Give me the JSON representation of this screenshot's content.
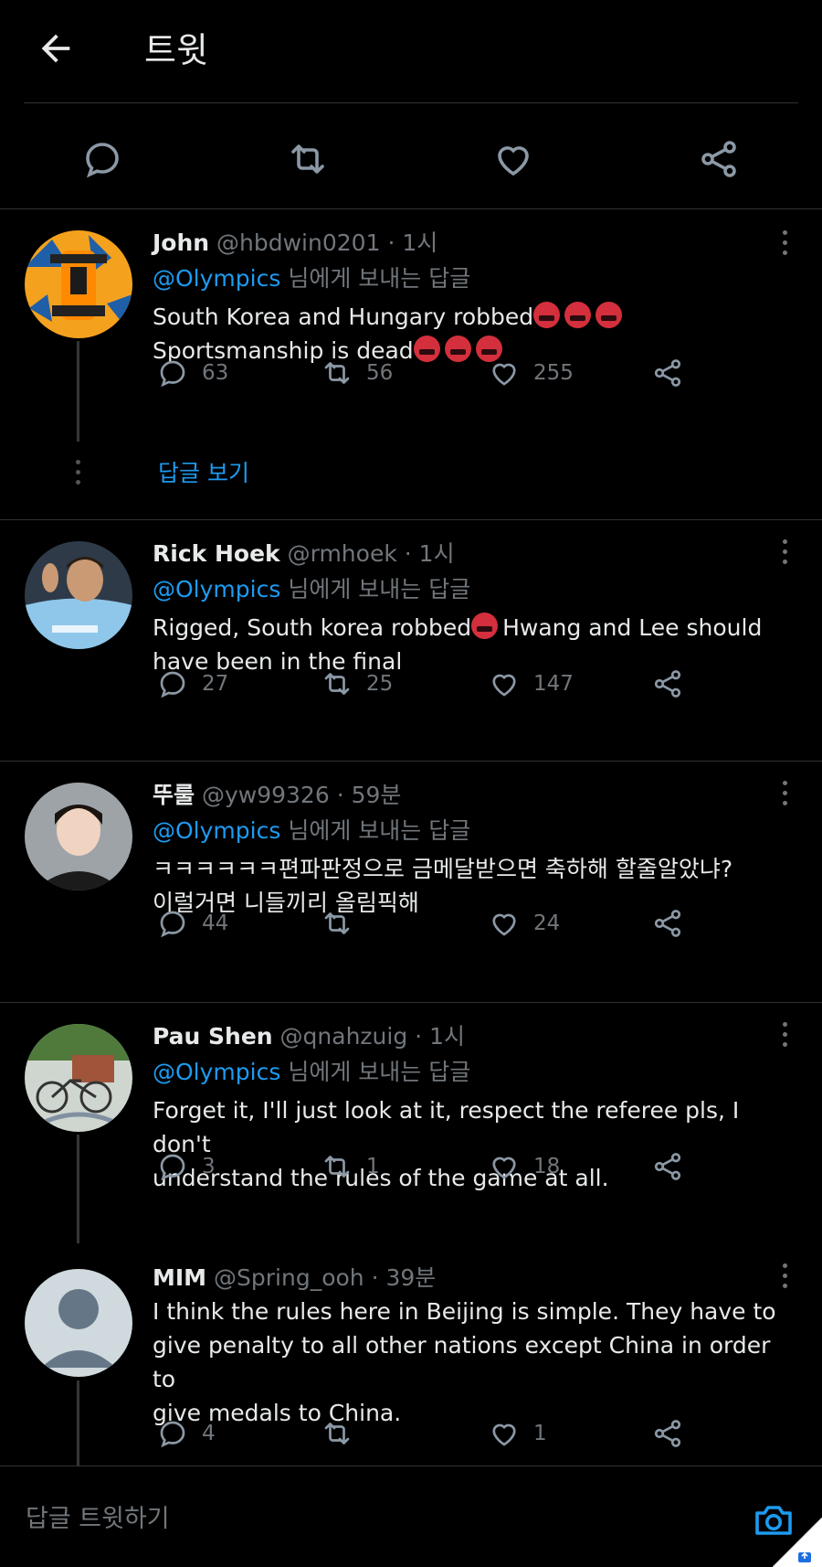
{
  "header": {
    "title": "트윗"
  },
  "tweets": [
    {
      "name": "John",
      "handle": "@hbdwin0201",
      "time": "· 1시",
      "reply_to": "@Olympics",
      "reply_suffix": "님에게 보내는 답글",
      "text_line1": "South Korea and Hungary robbed",
      "text_line2": "Sportsmanship is dead",
      "replies": "63",
      "retweets": "56",
      "likes": "255",
      "view_replies": "답글 보기"
    },
    {
      "name": "Rick Hoek",
      "handle": "@rmhoek",
      "time": "· 1시",
      "reply_to": "@Olympics",
      "reply_suffix": "님에게 보내는 답글",
      "text_line1a": "Rigged, South korea robbed",
      "text_line1b": "Hwang and Lee should",
      "text_line2": "have been in the final",
      "replies": "27",
      "retweets": "25",
      "likes": "147"
    },
    {
      "name": "뚜룰",
      "handle": "@yw99326",
      "time": "· 59분",
      "reply_to": "@Olympics",
      "reply_suffix": "님에게 보내는 답글",
      "text_line1": "ㅋㅋㅋㅋㅋㅋ편파판정으로 금메달받으면 축하해 할줄알았냐?",
      "text_line2": "이럴거면 니들끼리 올림픽해",
      "replies": "44",
      "retweets": "",
      "likes": "24"
    },
    {
      "name": "Pau Shen",
      "handle": "@qnahzuig",
      "time": "· 1시",
      "reply_to": "@Olympics",
      "reply_suffix": "님에게 보내는 답글",
      "text_line1": "Forget it, I'll just look at it, respect the referee pls, I don't",
      "text_line2": "understand the rules of the game at all.",
      "replies": "3",
      "retweets": "1",
      "likes": "18"
    },
    {
      "name": "MIM",
      "handle": "@Spring_ooh",
      "time": "· 39분",
      "text_line1": "I think the rules here in Beijing is simple. They have to",
      "text_line2": "give penalty to all other nations except China in order to",
      "text_line3": "give medals to China.",
      "replies": "4",
      "retweets": "",
      "likes": "1"
    }
  ],
  "compose": {
    "placeholder": "답글 트윗하기"
  },
  "colors": {
    "accent": "#1d9bf0",
    "muted": "#71767b",
    "background": "#000000",
    "divider": "#2f3336",
    "angry_emoji": "#d32f3c"
  }
}
